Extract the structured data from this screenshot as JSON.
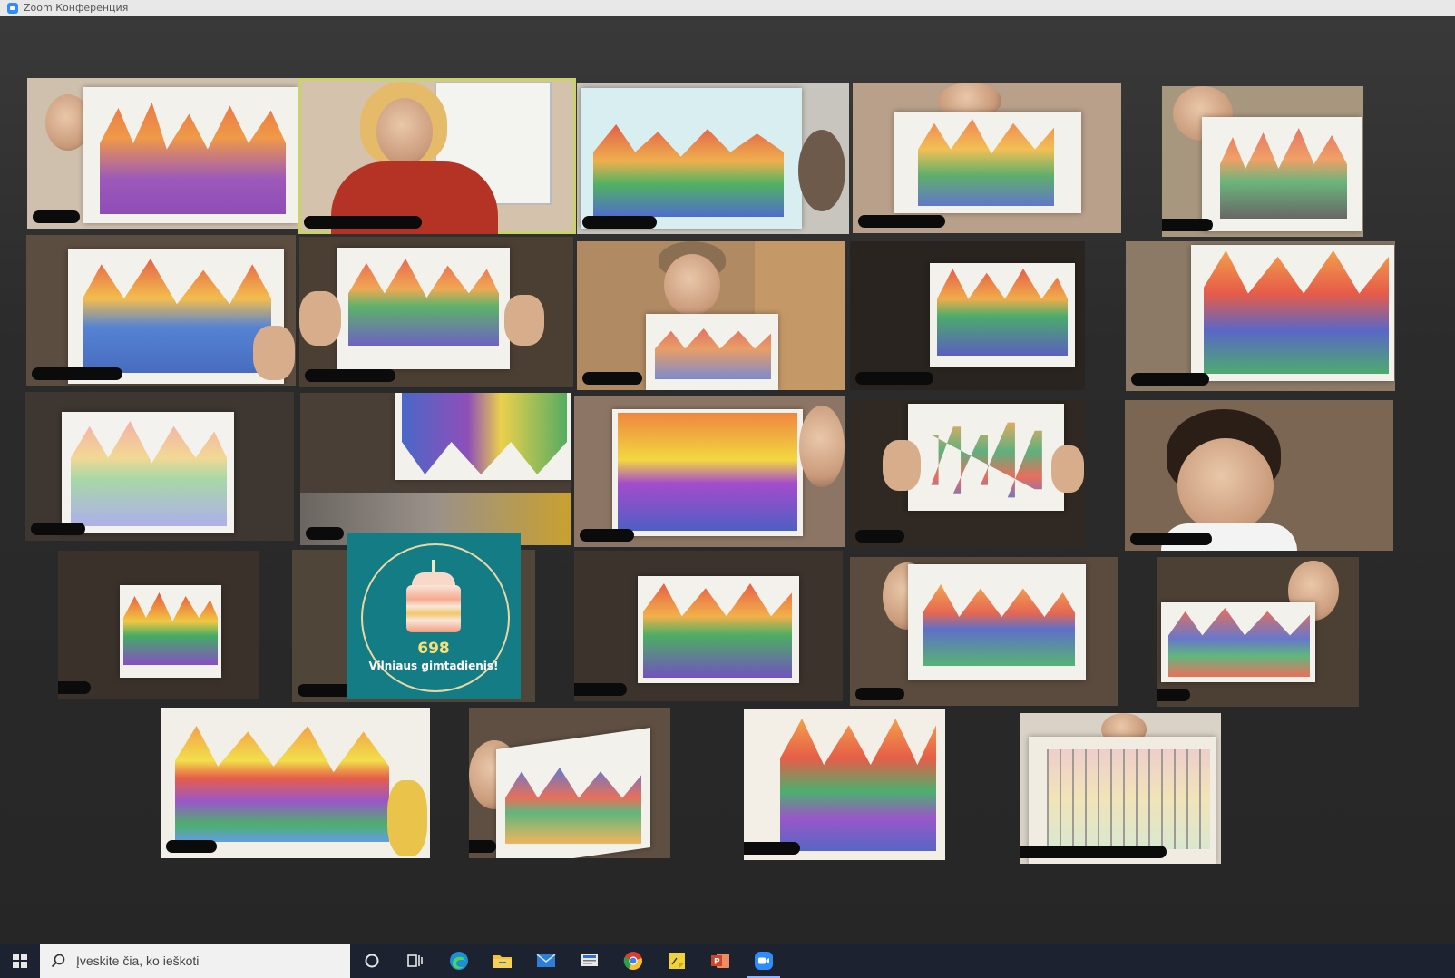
{
  "window": {
    "title": "Zoom Конференция"
  },
  "cake": {
    "number": "698",
    "caption": "Vilniaus gimtadienis!"
  },
  "taskbar": {
    "search_placeholder": "Įveskite čia, ko ieškoti",
    "apps": [
      "cortana-icon",
      "task-view-icon",
      "edge-icon",
      "file-explorer-icon",
      "mail-icon",
      "news-icon",
      "chrome-icon",
      "sticky-notes-icon",
      "powerpoint-icon",
      "zoom-icon"
    ]
  },
  "colors": {
    "accent": "#c9d36a",
    "taskbar": "#1d2230",
    "cake_bg": "#147c84",
    "zoom_blue": "#2d8cff"
  }
}
